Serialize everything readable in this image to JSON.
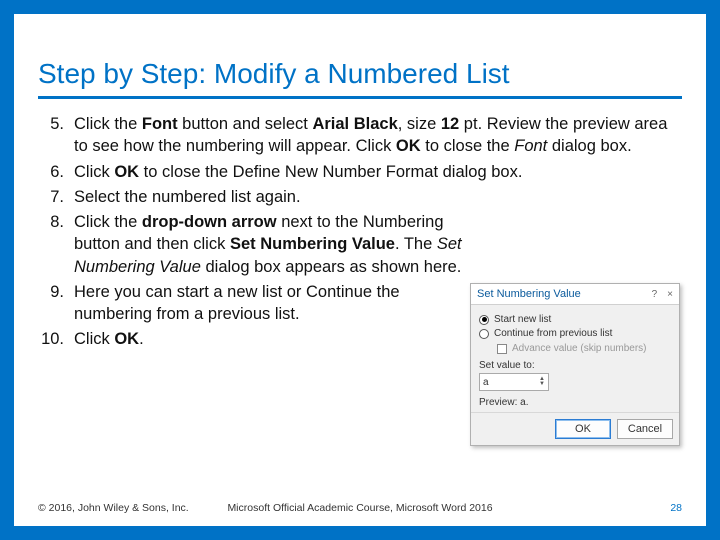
{
  "title": "Step by Step: Modify a Numbered List",
  "steps": [
    {
      "n": "5.",
      "html": "Click the <b>Font</b> button and select <b>Arial Black</b>, size <b>12</b> pt. Review the preview area to see how the numbering will appear. Click <b>OK</b> to close the <i>Font</i> dialog box."
    },
    {
      "n": "6.",
      "html": "Click <b>OK</b> to close the Define New Number Format dialog box."
    },
    {
      "n": "7.",
      "html": "Select the numbered list again."
    },
    {
      "n": "8.",
      "html": "Click the <b>drop-down arrow</b> next to the Numbering button and then click <b>Set Numbering Value</b>. The <i>Set Numbering Value</i> dialog box appears as shown here."
    },
    {
      "n": "9.",
      "html": "Here you can start a new list or Continue the numbering from a previous list."
    },
    {
      "n": "10.",
      "html": "Click <b>OK</b>."
    }
  ],
  "dialog": {
    "title": "Set Numbering Value",
    "help": "?",
    "close": "×",
    "opt_start": "Start new list",
    "opt_continue": "Continue from previous list",
    "chk_advance": "Advance value (skip numbers)",
    "set_label": "Set value to:",
    "set_value": "a",
    "preview_label": "Preview:",
    "preview_value": "a.",
    "ok": "OK",
    "cancel": "Cancel"
  },
  "footer": {
    "left": "© 2016, John Wiley & Sons, Inc.",
    "mid": "Microsoft Official Academic Course, Microsoft Word 2016",
    "page": "28"
  }
}
